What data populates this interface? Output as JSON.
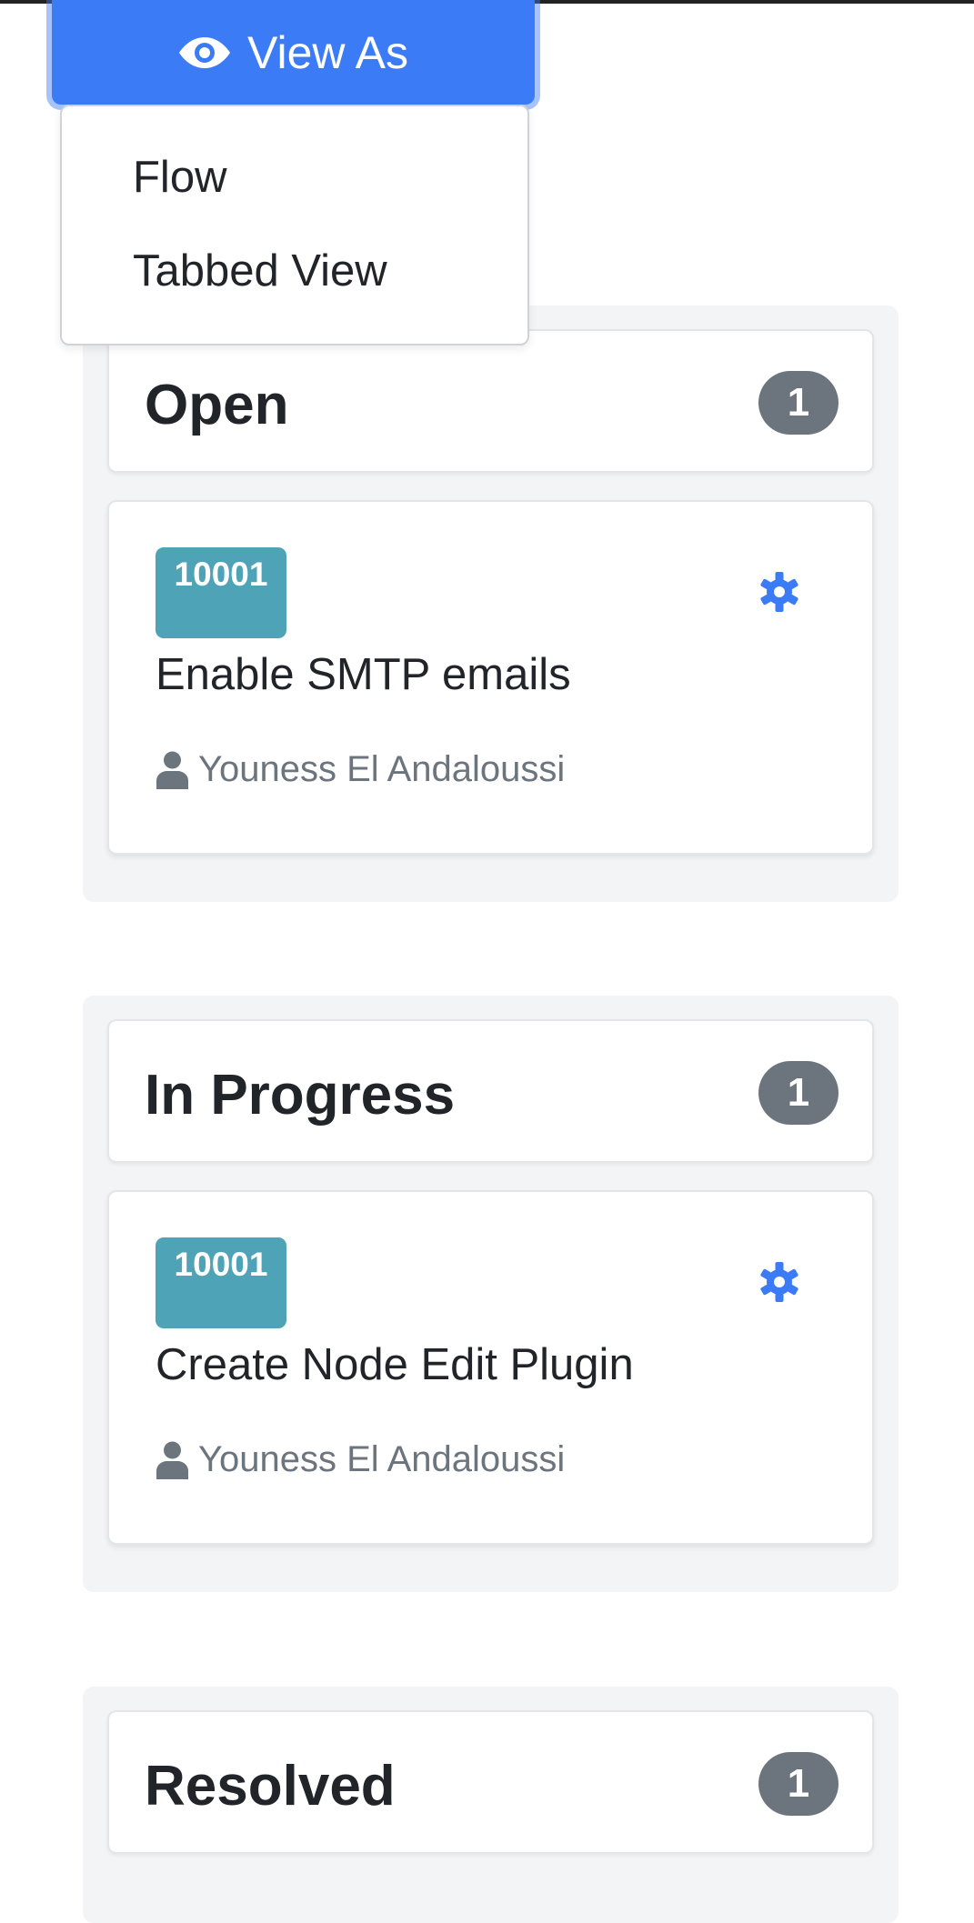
{
  "view_as": {
    "label": "View As",
    "icon": "eye-icon"
  },
  "dropdown": {
    "items": [
      "Flow",
      "Tabbed View"
    ]
  },
  "columns": [
    {
      "title": "Open",
      "count": "1",
      "cards": [
        {
          "id": "10001",
          "title": "Enable SMTP emails",
          "assignee": "Youness El Andaloussi"
        }
      ]
    },
    {
      "title": "In Progress",
      "count": "1",
      "cards": [
        {
          "id": "10001",
          "title": "Create Node Edit Plugin",
          "assignee": "Youness El Andaloussi"
        }
      ]
    },
    {
      "title": "Resolved",
      "count": "1",
      "cards": []
    }
  ],
  "colors": {
    "primary": "#3b7bf5",
    "id_badge": "#4fa3b7",
    "count_badge": "#6c757d",
    "column_bg": "#f3f4f6"
  }
}
